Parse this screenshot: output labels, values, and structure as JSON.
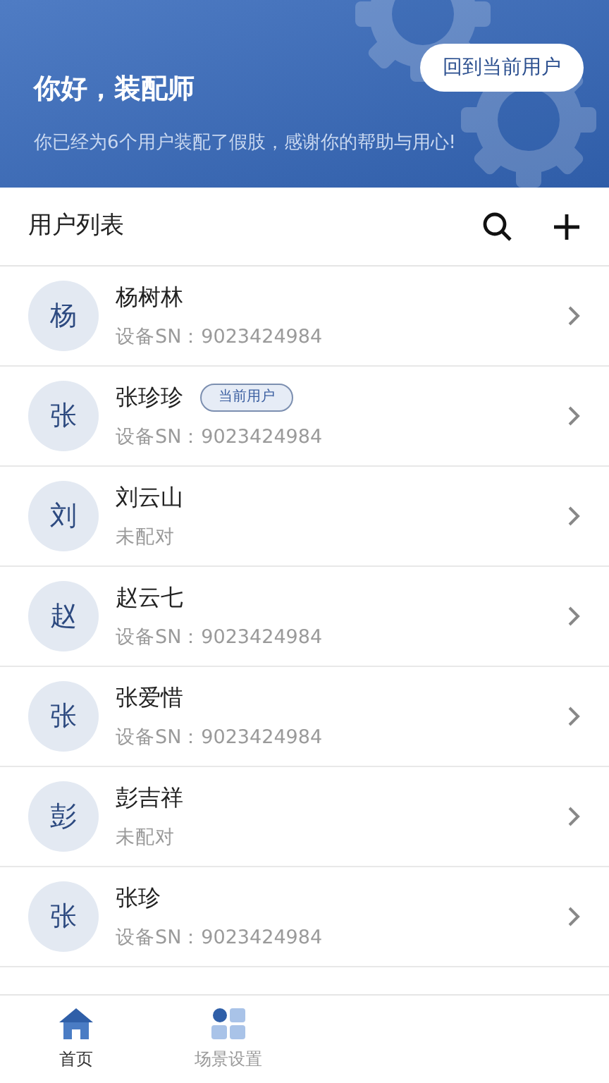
{
  "header": {
    "greeting": "你好，装配师",
    "message": "你已经为6个用户装配了假肢，感谢你的帮助与用心!",
    "button": "回到当前用户"
  },
  "list_header": {
    "title": "用户列表"
  },
  "users": [
    {
      "avatar": "杨",
      "name": "杨树林",
      "subtitle": "设备SN：9023424984"
    },
    {
      "avatar": "张",
      "name": "张珍珍",
      "badge": "当前用户",
      "subtitle": "设备SN：9023424984"
    },
    {
      "avatar": "刘",
      "name": "刘云山",
      "subtitle": "未配对"
    },
    {
      "avatar": "赵",
      "name": "赵云七",
      "subtitle": "设备SN：9023424984"
    },
    {
      "avatar": "张",
      "name": "张爱惜",
      "subtitle": "设备SN：9023424984"
    },
    {
      "avatar": "彭",
      "name": "彭吉祥",
      "subtitle": "未配对"
    },
    {
      "avatar": "张",
      "name": "张珍",
      "subtitle": "设备SN：9023424984"
    }
  ],
  "tabs": [
    {
      "label": "首页",
      "kind": "home",
      "selected": true
    },
    {
      "label": "场景设置",
      "kind": "scenes",
      "selected": false
    }
  ]
}
